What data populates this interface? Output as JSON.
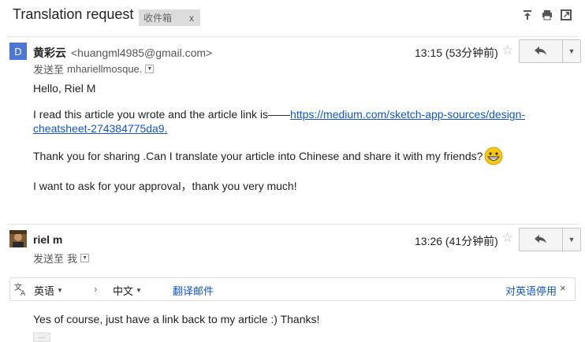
{
  "subject": "Translation request",
  "label": {
    "name": "收件箱",
    "remove": "x"
  },
  "toolbar": {
    "icons": [
      "expand-all-icon",
      "print-icon",
      "new-window-icon"
    ]
  },
  "message1": {
    "avatar_letter": "D",
    "sender_name": "黄彩云",
    "sender_email": "<huangml4985@gmail.com>",
    "to_prefix": "发送至",
    "to_value": "mhariellmosque.",
    "time": "13:15 (53分钟前)",
    "greeting": "Hello, Riel M",
    "para1_text": "I read this article you wrote and the article link is——",
    "para1_link_line1": "https://medium.com/sketch-app-sources/design-",
    "para1_link_line2": "cheatsheet-274384775da9.",
    "para2": "Thank you for sharing .Can I translate your article into Chinese and share it with my friends?",
    "para3": "I want to ask for your approval，thank you very much!"
  },
  "message2": {
    "sender_name": "riel m",
    "to_prefix": "发送至",
    "to_value": "我",
    "time": "13:26 (41分钟前)",
    "body": "Yes of course, just have a link back to my article :) Thanks!",
    "ellipsis": "···"
  },
  "translate_bar": {
    "from_lang": "英语",
    "to_lang": "中文",
    "translate_label": "翻译邮件",
    "disable_label": "对英语停用",
    "close": "×"
  }
}
